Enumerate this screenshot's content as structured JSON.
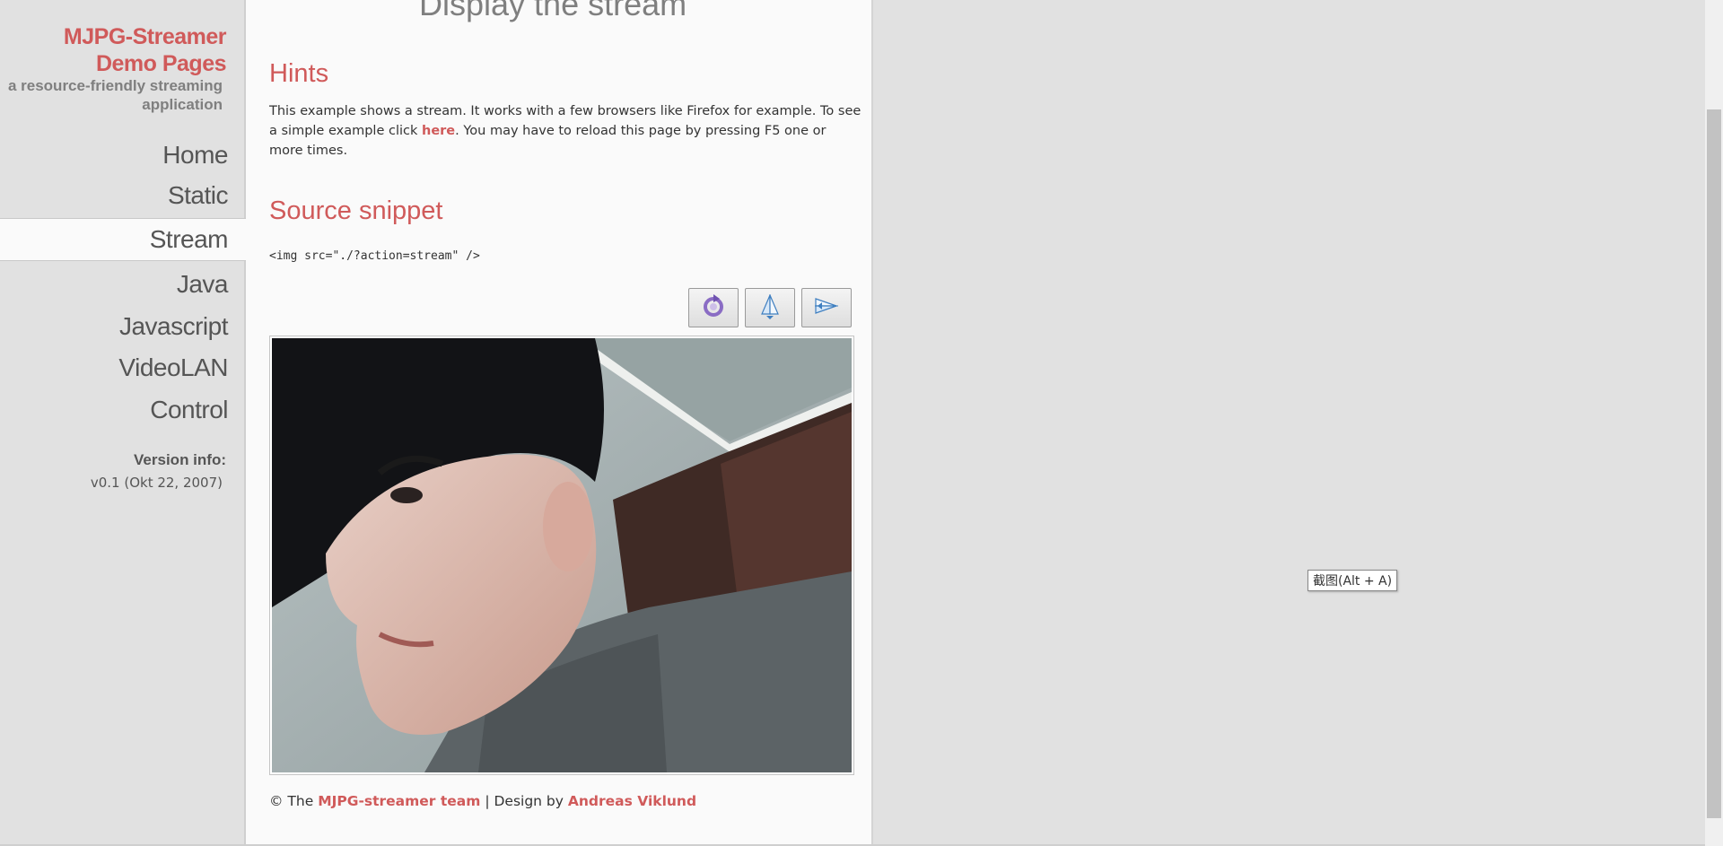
{
  "sidebar": {
    "title_line1": "MJPG-Streamer",
    "title_line2": "Demo Pages",
    "subtitle_line1": "a resource-friendly streaming",
    "subtitle_line2": "application",
    "nav": [
      "Home",
      "Static",
      "Stream",
      "Java",
      "Javascript",
      "VideoLAN",
      "Control"
    ],
    "active_item": "Stream",
    "version_label": "Version info:",
    "version_value": "v0.1 (Okt 22, 2007)"
  },
  "main": {
    "page_title": "Display the stream",
    "hints_heading": "Hints",
    "hints_text_before": "This example shows a stream. It works with a few browsers like Firefox for example. To see a simple example click ",
    "hints_link": "here",
    "hints_text_after": ". You may have to reload this page by pressing F5 one or more times.",
    "snippet_heading": "Source snippet",
    "snippet_code": "<img src=\"./?action=stream\" />",
    "toolbar": [
      "rotate-icon",
      "flip-vertical-icon",
      "flip-horizontal-icon"
    ],
    "footer_prefix": "© The ",
    "footer_link1": "MJPG-streamer team",
    "footer_middle": " | Design by ",
    "footer_link2": "Andreas Viklund"
  },
  "tooltip": "截图(Alt + A)",
  "colors": {
    "accent": "#d05a5a",
    "sidebar_bg": "#e1e1e1",
    "content_bg": "#fafafa"
  }
}
